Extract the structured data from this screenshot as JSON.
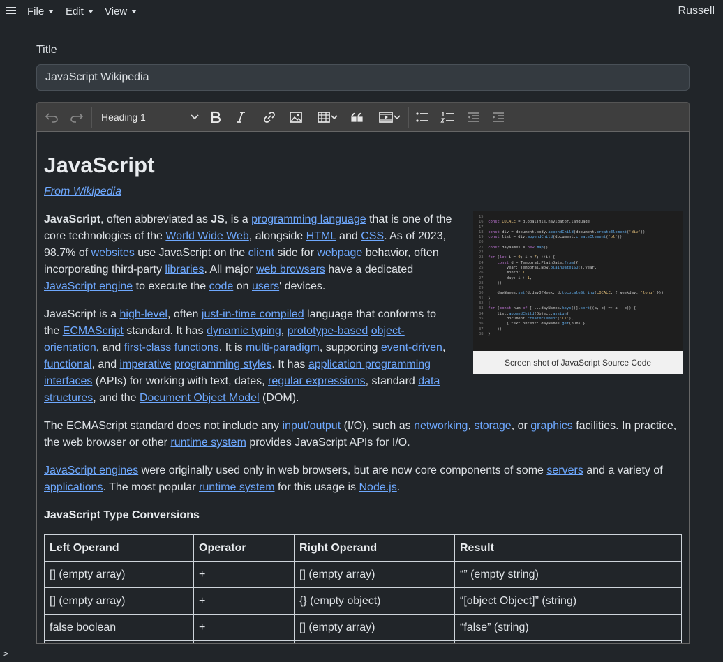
{
  "menubar": {
    "items": [
      "File",
      "Edit",
      "View"
    ],
    "user": "Russell"
  },
  "title_field": {
    "label": "Title",
    "value": "JavaScript Wikipedia"
  },
  "toolbar": {
    "heading_value": "Heading 1",
    "icons": [
      "undo-icon",
      "redo-icon",
      "bold-icon",
      "italic-icon",
      "link-icon",
      "image-icon",
      "table-icon",
      "blockquote-icon",
      "media-icon",
      "bulleted-list-icon",
      "numbered-list-icon",
      "outdent-icon",
      "indent-icon"
    ]
  },
  "article": {
    "heading": "JavaScript",
    "source_link": "From Wikipedia",
    "figure_caption": "Screen shot of JavaScript Source Code",
    "p1": [
      {
        "b": "JavaScript"
      },
      {
        "t": ", often abbreviated as "
      },
      {
        "b": "JS"
      },
      {
        "t": ", is a "
      },
      {
        "a": "programming language"
      },
      {
        "t": " that is one of the"
      },
      {
        "br": 1
      },
      {
        "t": "core technologies of the "
      },
      {
        "a": "World Wide Web"
      },
      {
        "t": ", alongside "
      },
      {
        "a": "HTML"
      },
      {
        "t": " and "
      },
      {
        "a": "CSS"
      },
      {
        "t": ". As of 2023,"
      },
      {
        "br": 1
      },
      {
        "t": "98.7% of "
      },
      {
        "a": "websites"
      },
      {
        "t": " use JavaScript on the "
      },
      {
        "a": "client"
      },
      {
        "t": " side for "
      },
      {
        "a": "webpage"
      },
      {
        "t": " behavior, often"
      },
      {
        "br": 1
      },
      {
        "t": "incorporating third-party "
      },
      {
        "a": "libraries"
      },
      {
        "t": ". All major "
      },
      {
        "a": "web browsers"
      },
      {
        "t": " have a dedicated"
      },
      {
        "br": 1
      },
      {
        "a": "JavaScript engine"
      },
      {
        "t": " to execute the "
      },
      {
        "a": "code"
      },
      {
        "t": " on "
      },
      {
        "a": "users"
      },
      {
        "t": "' devices."
      }
    ],
    "p2": [
      {
        "t": "JavaScript is a "
      },
      {
        "a": "high-level"
      },
      {
        "t": ", often "
      },
      {
        "a": "just-in-time compiled"
      },
      {
        "t": " language that conforms to"
      },
      {
        "br": 1
      },
      {
        "t": "the "
      },
      {
        "a": "ECMAScript"
      },
      {
        "t": " standard. It has "
      },
      {
        "a": "dynamic typing"
      },
      {
        "t": ", "
      },
      {
        "a": "prototype-based"
      },
      {
        "t": " "
      },
      {
        "a": "object-"
      },
      {
        "br": 1
      },
      {
        "a": "orientation"
      },
      {
        "t": ", and "
      },
      {
        "a": "first-class functions"
      },
      {
        "t": ". It is "
      },
      {
        "a": "multi-paradigm"
      },
      {
        "t": ", supporting "
      },
      {
        "a": "event-driven"
      },
      {
        "t": ","
      },
      {
        "br": 1
      },
      {
        "a": "functional"
      },
      {
        "t": ", and "
      },
      {
        "a": "imperative"
      },
      {
        "t": " "
      },
      {
        "a": "programming styles"
      },
      {
        "t": ". It has "
      },
      {
        "a": "application programming"
      },
      {
        "br": 1
      },
      {
        "a": "interfaces"
      },
      {
        "t": " (APIs) for working with text, dates, "
      },
      {
        "a": "regular expressions"
      },
      {
        "t": ", standard "
      },
      {
        "a": "data"
      },
      {
        "br": 1
      },
      {
        "a": "structures"
      },
      {
        "t": ", and the "
      },
      {
        "a": "Document Object Model"
      },
      {
        "t": " (DOM)."
      }
    ],
    "p3": [
      {
        "t": "The ECMAScript standard does not include any "
      },
      {
        "a": "input/output"
      },
      {
        "t": " (I/O), such as "
      },
      {
        "a": "networking"
      },
      {
        "t": ", "
      },
      {
        "a": "storage"
      },
      {
        "t": ", or "
      },
      {
        "a": "graphics"
      },
      {
        "t": " facilities. In practice,"
      },
      {
        "br": 1
      },
      {
        "t": "the web browser or other "
      },
      {
        "a": "runtime system"
      },
      {
        "t": " provides JavaScript APIs for I/O."
      }
    ],
    "p4": [
      {
        "a": "JavaScript engines"
      },
      {
        "t": " were originally used only in web browsers, but are now core components of some "
      },
      {
        "a": "servers"
      },
      {
        "t": " and a variety of"
      },
      {
        "br": 1
      },
      {
        "a": "applications"
      },
      {
        "t": ". The most popular "
      },
      {
        "a": "runtime system"
      },
      {
        "t": " for this usage is "
      },
      {
        "a": "Node.js"
      },
      {
        "t": "."
      }
    ],
    "table_heading": "JavaScript Type Conversions",
    "table": {
      "headers": [
        "Left Operand",
        "Operator",
        "Right Operand",
        "Result"
      ],
      "rows": [
        [
          "[] (empty array)",
          "+",
          "[] (empty array)",
          "“” (empty string)"
        ],
        [
          "[] (empty array)",
          "+",
          "{} (empty object)",
          "“[object Object]” (string)"
        ],
        [
          "false boolean",
          "+",
          "[] (empty array)",
          "“false” (string)"
        ],
        [
          "",
          "",
          "",
          ""
        ]
      ]
    }
  },
  "console_prompt": ">"
}
